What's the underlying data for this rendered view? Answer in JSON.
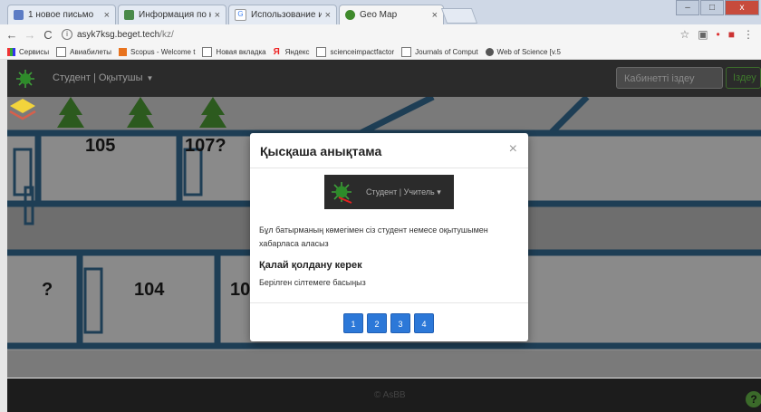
{
  "browser": {
    "tabs": [
      {
        "title": "1 новое письмо",
        "fav_color": "#5c7cc5"
      },
      {
        "title": "Информация по конфе",
        "fav_color": "#4a8a4a"
      },
      {
        "title": "Использование интерак",
        "fav_color": "#d74a3c"
      },
      {
        "title": "Geo Map",
        "fav_color": "#3f8a2b"
      }
    ],
    "window_buttons": [
      "–",
      "□",
      "x"
    ],
    "url": "asyk7ksg.beget.tech",
    "url_path": "/kz/",
    "bookmarks": [
      "Сервисы",
      "Авиабилеты",
      "Scopus - Welcome t",
      "Новая вкладка",
      "Яндекс",
      "scienceimpactfactor",
      "Journals of Comput",
      "Web of Science [v.5"
    ]
  },
  "app": {
    "brand": "Студент | Оқытушы",
    "search_placeholder": "Кабинетті іздеу",
    "search_button": "Іздеу",
    "footer_text": "© AsBB",
    "help_label": "?"
  },
  "map": {
    "rooms": [
      "105",
      "107?",
      "?",
      "104",
      "10"
    ]
  },
  "modal": {
    "title": "Қысқаша анықтама",
    "close_label": "×",
    "preview_label": "Студент | Учитель",
    "description": "Бұл батырманың көмегімен сіз студент немесе оқытушымен хабарласа аласыз",
    "how_title": "Қалай қолдану керек",
    "step_text": "Берілген сілтемеге басыңыз",
    "pages": [
      "1",
      "2",
      "3",
      "4"
    ]
  },
  "colors": {
    "accent": "#2c78d8",
    "navbar": "#2b2b2b",
    "map_walls": "#1e3e55"
  }
}
